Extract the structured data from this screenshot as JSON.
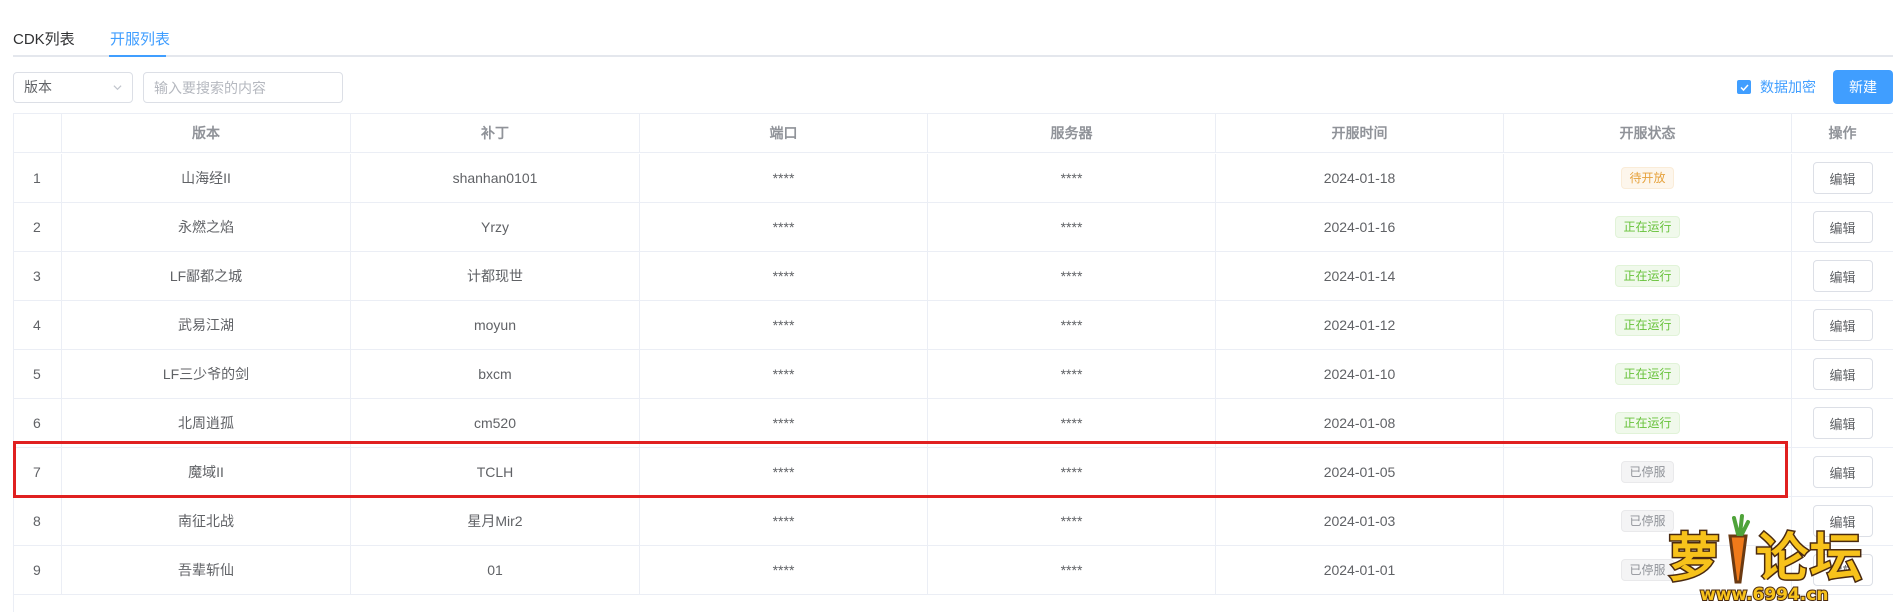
{
  "tabs": [
    {
      "label": "CDK列表",
      "active": false
    },
    {
      "label": "开服列表",
      "active": true
    }
  ],
  "toolbar": {
    "select_value": "版本",
    "search_placeholder": "输入要搜索的内容",
    "encrypt_label": "数据加密",
    "encrypt_checked": true,
    "new_label": "新建"
  },
  "table": {
    "columns": [
      "",
      "版本",
      "补丁",
      "端口",
      "服务器",
      "开服时间",
      "开服状态",
      "操作"
    ],
    "rows": [
      {
        "index": "1",
        "version": "山海经II",
        "patch": "shanhan0101",
        "port": "****",
        "server": "****",
        "date": "2024-01-18",
        "status": "待开放",
        "status_type": "warning",
        "action": "编辑"
      },
      {
        "index": "2",
        "version": "永燃之焰",
        "patch": "Yrzy",
        "port": "****",
        "server": "****",
        "date": "2024-01-16",
        "status": "正在运行",
        "status_type": "success",
        "action": "编辑"
      },
      {
        "index": "3",
        "version": "LF鄙都之城",
        "patch": "计都现世",
        "port": "****",
        "server": "****",
        "date": "2024-01-14",
        "status": "正在运行",
        "status_type": "success",
        "action": "编辑"
      },
      {
        "index": "4",
        "version": "武易江湖",
        "patch": "moyun",
        "port": "****",
        "server": "****",
        "date": "2024-01-12",
        "status": "正在运行",
        "status_type": "success",
        "action": "编辑"
      },
      {
        "index": "5",
        "version": "LF三少爷的剑",
        "patch": "bxcm",
        "port": "****",
        "server": "****",
        "date": "2024-01-10",
        "status": "正在运行",
        "status_type": "success",
        "action": "编辑"
      },
      {
        "index": "6",
        "version": "北周逍孤",
        "patch": "cm520",
        "port": "****",
        "server": "****",
        "date": "2024-01-08",
        "status": "正在运行",
        "status_type": "success",
        "action": "编辑"
      },
      {
        "index": "7",
        "version": "魔域II",
        "patch": "TCLH",
        "port": "****",
        "server": "****",
        "date": "2024-01-05",
        "status": "已停服",
        "status_type": "info",
        "action": "编辑"
      },
      {
        "index": "8",
        "version": "南征北战",
        "patch": "星月Mir2",
        "port": "****",
        "server": "****",
        "date": "2024-01-03",
        "status": "已停服",
        "status_type": "info",
        "action": "编辑"
      },
      {
        "index": "9",
        "version": "吾辈斩仙",
        "patch": "01",
        "port": "****",
        "server": "****",
        "date": "2024-01-01",
        "status": "已停服",
        "status_type": "info",
        "action": "编辑"
      }
    ]
  },
  "watermark": {
    "title": "萝卜论坛",
    "url": "www.6994.cn"
  },
  "colors": {
    "primary": "#409eff",
    "highlight": "#e02020",
    "success": "#67c23a",
    "warning": "#e6a23c",
    "info": "#909399"
  }
}
